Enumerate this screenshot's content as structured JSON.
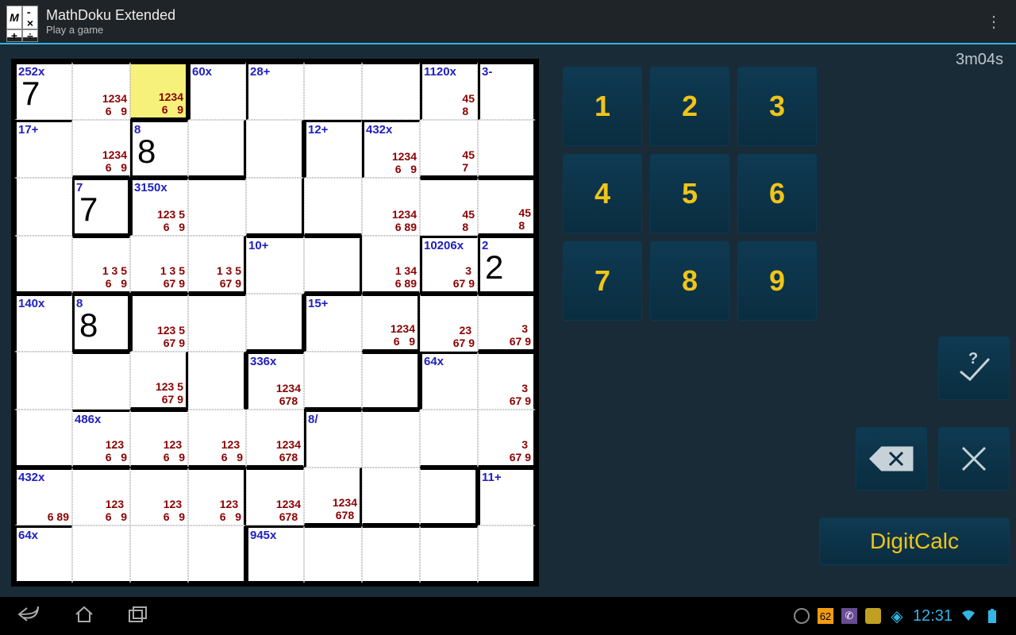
{
  "app": {
    "title": "MathDoku Extended",
    "subtitle": "Play a game"
  },
  "timer": "3m04s",
  "clock": "12:31",
  "digitcalc_label": "DigitCalc",
  "keypad": [
    "1",
    "2",
    "3",
    "4",
    "5",
    "6",
    "7",
    "8",
    "9"
  ],
  "grid": {
    "size": 9,
    "selected": [
      0,
      2
    ],
    "cells": [
      [
        {
          "cage": "252x",
          "val": "7",
          "w": "tl"
        },
        {
          "maybe": "1234\n6   9",
          "w": "t"
        },
        {
          "maybe": "1234\n6   9",
          "w": "trb"
        },
        {
          "cage": "60x",
          "w": "tl"
        },
        {
          "cage": "28+",
          "w": "tl"
        },
        {
          "w": "t"
        },
        {
          "w": "t"
        },
        {
          "cage": "1120x",
          "maybe": "  45\n 8  ",
          "w": "tl"
        },
        {
          "cage": "3-",
          "w": "trl"
        }
      ],
      [
        {
          "cage": "17+",
          "w": "tl"
        },
        {
          "maybe": "1234\n6   9",
          "w": "b"
        },
        {
          "cage": "8",
          "val": "8",
          "w": "tlb"
        },
        {
          "w": "rb"
        },
        {
          "w": "r"
        },
        {
          "cage": "12+",
          "w": "tl"
        },
        {
          "cage": "432x",
          "maybe": "1234\n6   9",
          "w": "tl"
        },
        {
          "maybe": "  45\n 7  ",
          "w": "b"
        },
        {
          "w": "rb"
        }
      ],
      [
        {
          "w": "l"
        },
        {
          "cage": "7",
          "val": "7",
          "w": "tlrb"
        },
        {
          "cage": "3150x",
          "maybe": "123 5\n6   9",
          "w": "tl"
        },
        {
          "w": "t"
        },
        {
          "w": "rb"
        },
        {
          "w": "b"
        },
        {
          "maybe": "1234\n6 89",
          "w": ""
        },
        {
          "maybe": "  45\n 8  ",
          "w": "t"
        },
        {
          "maybe": "  45\n 8  ",
          "w": "trb"
        }
      ],
      [
        {
          "w": "lb"
        },
        {
          "maybe": "1 3 5\n6   9",
          "w": "tb"
        },
        {
          "maybe": "1 3 5\n67 9",
          "w": "b"
        },
        {
          "maybe": "1 3 5\n67 9",
          "w": "rb"
        },
        {
          "cage": "10+",
          "w": "t"
        },
        {
          "w": "trb"
        },
        {
          "maybe": "1 34\n6 89",
          "w": "b"
        },
        {
          "cage": "10206x",
          "maybe": "   3 \n67 9",
          "w": "tlb"
        },
        {
          "cage": "2",
          "val": "2",
          "w": "tlrb"
        }
      ],
      [
        {
          "cage": "140x",
          "w": "tl"
        },
        {
          "cage": "8",
          "val": "8",
          "w": "tlrb"
        },
        {
          "maybe": "123 5\n67 9",
          "w": "tl"
        },
        {
          "w": "t"
        },
        {
          "w": "rb"
        },
        {
          "cage": "15+",
          "w": "tl"
        },
        {
          "maybe": "1234\n6   9",
          "w": "trb"
        },
        {
          "maybe": " 23 \n67 9",
          "w": "t"
        },
        {
          "maybe": "   3 \n67 9",
          "w": "trb"
        }
      ],
      [
        {
          "w": "l"
        },
        {
          "w": "t"
        },
        {
          "maybe": "123 5\n67 9",
          "w": "rb"
        },
        {
          "w": "r"
        },
        {
          "cage": "336x",
          "maybe": "1234\n678 ",
          "w": "tl"
        },
        {
          "w": "b"
        },
        {
          "w": "trb"
        },
        {
          "cage": "64x",
          "w": "tl"
        },
        {
          "maybe": "   3 \n67 9",
          "w": "tr"
        }
      ],
      [
        {
          "w": "lb"
        },
        {
          "cage": "486x",
          "maybe": "123 \n6   9",
          "w": "tb"
        },
        {
          "maybe": "123 \n6   9",
          "w": "tb"
        },
        {
          "maybe": "123 \n6   9",
          "w": "b"
        },
        {
          "maybe": "1234\n678 ",
          "w": "b"
        },
        {
          "cage": "8/",
          "w": "tl"
        },
        {
          "w": "t"
        },
        {
          "w": "b"
        },
        {
          "maybe": "   3 \n67 9",
          "w": "rb"
        }
      ],
      [
        {
          "cage": "432x",
          "maybe": "\n6 89",
          "w": "tl"
        },
        {
          "maybe": "123 \n6   9",
          "w": "t"
        },
        {
          "maybe": "123 \n6   9",
          "w": "t"
        },
        {
          "maybe": "123 \n6   9",
          "w": "tr"
        },
        {
          "maybe": "1234\n678 ",
          "w": "t"
        },
        {
          "maybe": "1234\n678 ",
          "w": "rb"
        },
        {
          "w": "b"
        },
        {
          "w": "trb"
        },
        {
          "cage": "11+",
          "w": "tlr"
        }
      ],
      [
        {
          "cage": "64x",
          "w": "tlb"
        },
        {
          "w": "b"
        },
        {
          "w": "b"
        },
        {
          "w": "rb"
        },
        {
          "cage": "945x",
          "w": "tbl"
        },
        {
          "w": "tb"
        },
        {
          "w": "tb"
        },
        {
          "w": "tb"
        },
        {
          "w": "rb"
        }
      ]
    ]
  }
}
